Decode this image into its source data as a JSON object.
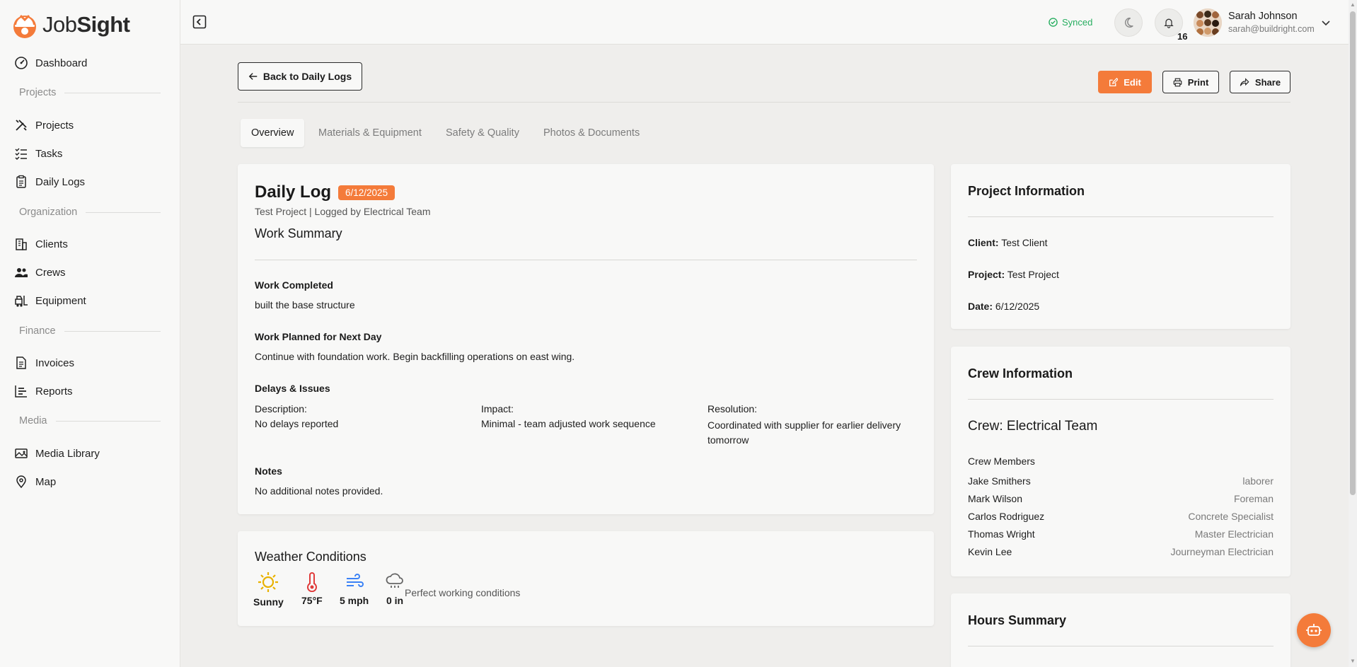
{
  "app": {
    "name_light": "Job",
    "name_bold": "Sight"
  },
  "sidebar": {
    "items": [
      {
        "label": "Dashboard",
        "icon": "dashboard-icon"
      },
      {
        "label": "Projects",
        "icon": "tools-icon"
      },
      {
        "label": "Tasks",
        "icon": "checklist-icon"
      },
      {
        "label": "Daily Logs",
        "icon": "clipboard-icon"
      },
      {
        "label": "Clients",
        "icon": "building-icon"
      },
      {
        "label": "Crews",
        "icon": "users-icon"
      },
      {
        "label": "Equipment",
        "icon": "forklift-icon"
      },
      {
        "label": "Invoices",
        "icon": "invoice-icon"
      },
      {
        "label": "Reports",
        "icon": "bar-chart-icon"
      },
      {
        "label": "Media Library",
        "icon": "image-icon"
      },
      {
        "label": "Map",
        "icon": "map-pin-icon"
      }
    ],
    "sections": [
      "Projects",
      "Organization",
      "Finance",
      "Media"
    ]
  },
  "topbar": {
    "sync_status": "Synced",
    "notification_count": "16",
    "user_name": "Sarah Johnson",
    "user_email": "sarah@buildright.com"
  },
  "actions": {
    "back": "Back to Daily Logs",
    "edit": "Edit",
    "print": "Print",
    "share": "Share"
  },
  "tabs": [
    "Overview",
    "Materials & Equipment",
    "Safety & Quality",
    "Photos & Documents"
  ],
  "log": {
    "title": "Daily Log",
    "date": "6/12/2025",
    "subtitle": "Test Project | Logged by Electrical Team",
    "work_summary_heading": "Work Summary",
    "work_completed_label": "Work Completed",
    "work_completed": "built the base structure",
    "work_planned_label": "Work Planned for Next Day",
    "work_planned": "Continue with foundation work. Begin backfilling operations on east wing.",
    "delays_label": "Delays & Issues",
    "description_label": "Description:",
    "description": "No delays reported",
    "impact_label": "Impact:",
    "impact": "Minimal - team adjusted work sequence",
    "resolution_label": "Resolution:",
    "resolution": "Coordinated with supplier for earlier delivery tomorrow",
    "notes_label": "Notes",
    "notes": "No additional notes provided."
  },
  "weather": {
    "heading": "Weather Conditions",
    "condition": "Sunny",
    "temperature": "75°F",
    "wind": "5 mph",
    "precipitation": "0 in",
    "note": "Perfect working conditions"
  },
  "project_info": {
    "heading": "Project Information",
    "client_label": "Client:",
    "client": "Test Client",
    "project_label": "Project:",
    "project": "Test Project",
    "date_label": "Date:",
    "date": "6/12/2025"
  },
  "crew_info": {
    "heading": "Crew Information",
    "crew_name": "Crew: Electrical Team",
    "members_label": "Crew Members",
    "members": [
      {
        "name": "Jake Smithers",
        "role": "laborer"
      },
      {
        "name": "Mark Wilson",
        "role": "Foreman"
      },
      {
        "name": "Carlos Rodriguez",
        "role": "Concrete Specialist"
      },
      {
        "name": "Thomas Wright",
        "role": "Master Electrician"
      },
      {
        "name": "Kevin Lee",
        "role": "Journeyman Electrician"
      }
    ]
  },
  "hours": {
    "heading": "Hours Summary"
  },
  "colors": {
    "accent": "#f47b3a",
    "synced": "#27ae60",
    "sun": "#e8b100",
    "thermo": "#e03b3b",
    "wind": "#3b82f6"
  }
}
